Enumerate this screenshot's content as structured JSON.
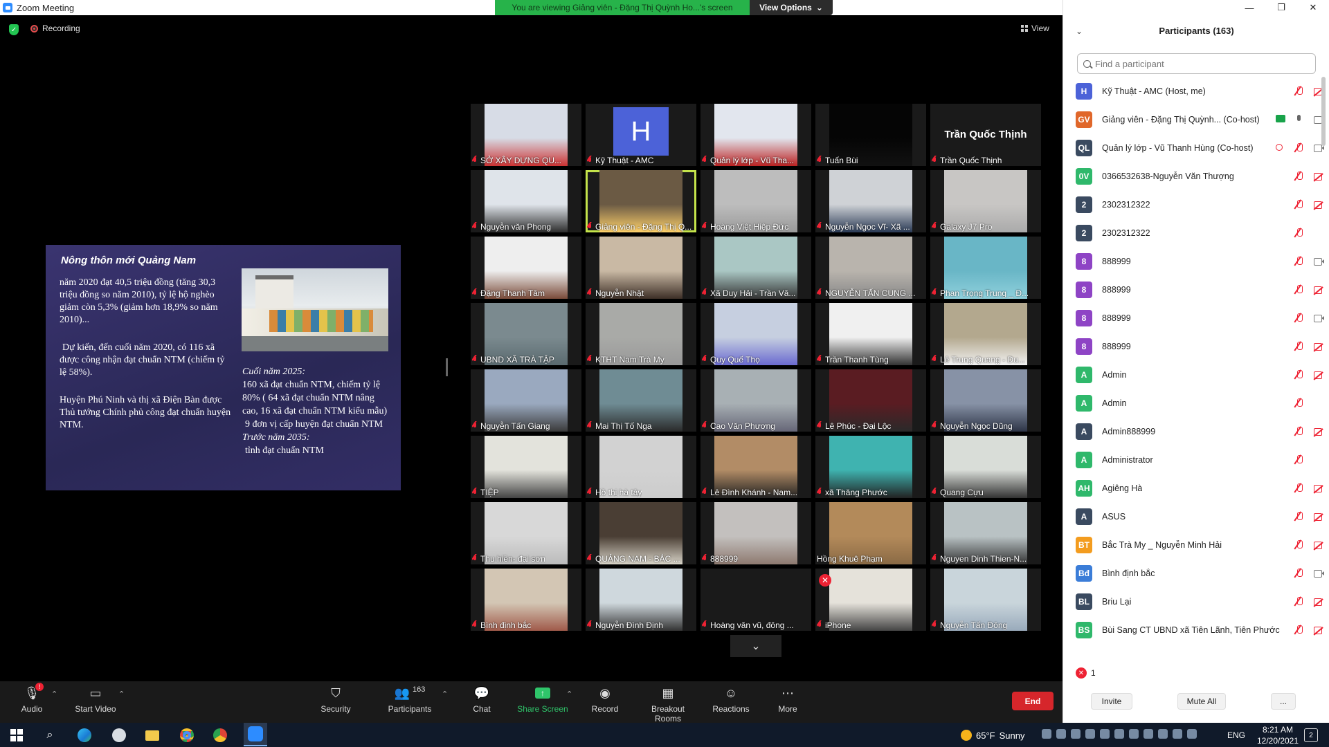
{
  "window": {
    "title": "Zoom Meeting",
    "share_banner": "You are viewing Giảng viên - Đặng Thị Quỳnh Ho...'s screen",
    "view_options": "View Options"
  },
  "meeting": {
    "recording_label": "Recording",
    "view_label": "View"
  },
  "slide": {
    "title": "Nông thôn mới Quảng Nam",
    "p1": "năm 2020 đạt 40,5 triệu đồng (tăng 30,3 triệu đồng so năm 2010), tỷ lệ hộ nghèo giảm còn 5,3% (giảm hơn 18,9% so năm 2010)...",
    "p2": "Dự kiến, đến cuối năm 2020, có 116 xã được công nhận đạt chuẩn NTM (chiếm tỷ lệ 58%).",
    "p3": "Huyện Phú Ninh và thị xã Điện Bàn được Thủ tướng Chính phủ công đạt chuẩn huyện NTM.",
    "p4_h1": "Cuối năm 2025:",
    "p4_t1": "160 xã đạt chuẩn NTM, chiếm tỷ lệ 80% ( 64 xã đạt chuẩn NTM nâng cao, 16 xã đạt chuẩn NTM kiểu mẫu)",
    "p4_t2": "9 đơn vị cấp huyện đạt chuẩn NTM",
    "p4_h2": "Trước năm 2035:",
    "p4_t3": "tỉnh đạt chuẩn NTM"
  },
  "gallery": [
    {
      "name": "SỞ XÂY DỰNG QU...",
      "kind": "video",
      "bg": "#d7dce6",
      "accent": "#c33"
    },
    {
      "name": "Kỹ Thuật - AMC",
      "kind": "avatar",
      "letter": "H"
    },
    {
      "name": "Quản lý lớp - Vũ Tha...",
      "kind": "video",
      "bg": "#e2e6ee",
      "accent": "#b22"
    },
    {
      "name": "Tuấn Bùi",
      "kind": "video",
      "bg": "#050505",
      "accent": "#111"
    },
    {
      "name": "Trần Quốc Thịnh",
      "kind": "nameonly",
      "big": "Trần Quốc Thịnh"
    },
    {
      "name": "Nguyễn văn Phong",
      "kind": "video",
      "bg": "#dfe4ea",
      "accent": "#2d2d2d"
    },
    {
      "name": "Giảng viên - Đặng Thị Q...",
      "kind": "video",
      "bg": "#6b5a44",
      "accent": "#ffd26b",
      "active": true
    },
    {
      "name": "Hoàng Việt Hiệp Đức",
      "kind": "video",
      "bg": "#bdbdbd",
      "accent": "#9a9a9a"
    },
    {
      "name": "Nguyễn Ngọc Vĩ- Xã ...",
      "kind": "video",
      "bg": "#cfd2d6",
      "accent": "#2a3a55"
    },
    {
      "name": "Galaxy J7 Pro",
      "kind": "video",
      "bg": "#c8c6c4",
      "accent": "#aaa"
    },
    {
      "name": "Đặng Thanh Tâm",
      "kind": "video",
      "bg": "#eeeeee",
      "accent": "#7a4b3a"
    },
    {
      "name": "Nguyễn Nhật",
      "kind": "video",
      "bg": "#c9b9a4",
      "accent": "#3d2f27"
    },
    {
      "name": "Xã Duy Hải - Trần Vă...",
      "kind": "video",
      "bg": "#aac7c4",
      "accent": "#333"
    },
    {
      "name": "NGUYỄN TẤN CUNG ...",
      "kind": "video",
      "bg": "#b9b4ad",
      "accent": "#888"
    },
    {
      "name": "Phan Trọng Trung _ Đ...",
      "kind": "video",
      "bg": "#69b6c6",
      "accent": "#8fd0dc"
    },
    {
      "name": "UBND XÃ TRÀ TẬP",
      "kind": "video",
      "bg": "#7b8a8f",
      "accent": "#5a6a6f"
    },
    {
      "name": "KTHT Nam Trà My",
      "kind": "video",
      "bg": "#a9aaa7",
      "accent": "#999"
    },
    {
      "name": "Quy Quế Thọ",
      "kind": "video",
      "bg": "#c6cfe0",
      "accent": "#6a6ad0"
    },
    {
      "name": "Trần Thanh Tùng",
      "kind": "video",
      "bg": "#f0f0f0",
      "accent": "#333"
    },
    {
      "name": "Lê Trung Quang - Du...",
      "kind": "video",
      "bg": "#b3a88e",
      "accent": "#f2f2f2"
    },
    {
      "name": "Nguyễn Tấn Giang",
      "kind": "video",
      "bg": "#9aa9bf",
      "accent": "#3a3a3a"
    },
    {
      "name": "Mai Thị Tố Nga",
      "kind": "video",
      "bg": "#6f8c94",
      "accent": "#2a2a2a"
    },
    {
      "name": "Cao Văn Phương",
      "kind": "video",
      "bg": "#a8b0b4",
      "accent": "#667"
    },
    {
      "name": "Lê Phúc - Đại Lộc",
      "kind": "video",
      "bg": "#5a1c22",
      "accent": "#2a2a2a"
    },
    {
      "name": "Nguyễn Ngọc Dũng",
      "kind": "video",
      "bg": "#8792a6",
      "accent": "#2d3446"
    },
    {
      "name": "TIỆP",
      "kind": "video",
      "bg": "#e3e3dc",
      "accent": "#444"
    },
    {
      "name": "Hồ thị hà tây",
      "kind": "video",
      "bg": "#d2d2d2",
      "accent": "#ccc"
    },
    {
      "name": "Lê Đình Khánh - Nam...",
      "kind": "video",
      "bg": "#b28c66",
      "accent": "#222"
    },
    {
      "name": "xã Thăng Phước",
      "kind": "video",
      "bg": "#3fb3b0",
      "accent": "#222"
    },
    {
      "name": "Quang Cựu",
      "kind": "video",
      "bg": "#d9ddd8",
      "accent": "#333"
    },
    {
      "name": "Thu hiền- đại sơn",
      "kind": "video",
      "bg": "#d8d8d8",
      "accent": "#bbb"
    },
    {
      "name": "QUẢNG NAM - BẮC ...",
      "kind": "video",
      "bg": "#4a3e34",
      "accent": "#d8d4c8"
    },
    {
      "name": "888999",
      "kind": "video",
      "bg": "#c3c0be",
      "accent": "#8e7a70"
    },
    {
      "name": "Hồng Khuê Phạm",
      "kind": "video",
      "bg": "#b38a5a",
      "accent": "#8a6a45",
      "nomic": true
    },
    {
      "name": "Nguyen Dinh Thien-N...",
      "kind": "video",
      "bg": "#b9c2c4",
      "accent": "#333"
    },
    {
      "name": "Bình định bắc",
      "kind": "video",
      "bg": "#d3c6b4",
      "accent": "#a05a4a"
    },
    {
      "name": "Nguyễn Đình Định",
      "kind": "video",
      "bg": "#cfd8dd",
      "accent": "#333"
    },
    {
      "name": "Hoàng văn vũ, đông ...",
      "kind": "blank"
    },
    {
      "name": "iPhone",
      "kind": "video",
      "bg": "#e5e2da",
      "accent": "#444",
      "xbadge": true
    },
    {
      "name": "Nguyễn Tấn Đông",
      "kind": "video",
      "bg": "#c9d5db",
      "accent": "#9ab"
    }
  ],
  "toolbar": {
    "audio": "Audio",
    "audio_badge": "!",
    "start_video": "Start Video",
    "security": "Security",
    "participants": "Participants",
    "participants_count": "163",
    "chat": "Chat",
    "share_screen": "Share Screen",
    "record": "Record",
    "breakout": "Breakout Rooms",
    "reactions": "Reactions",
    "more": "More",
    "end": "End"
  },
  "panel": {
    "title": "Participants (163)",
    "search_placeholder": "Find a participant",
    "participants": [
      {
        "initials": "H",
        "color": "#4c62d8",
        "name": "Kỹ Thuật - AMC (Host, me)",
        "mic": "off",
        "video": "off"
      },
      {
        "initials": "GV",
        "color": "#e0672a",
        "name": "Giảng viên - Đặng Thị Quỳnh... (Co-host)",
        "mic": "on",
        "video": "on",
        "sharing": true
      },
      {
        "initials": "QL",
        "color": "#3a4a60",
        "name": "Quản lý lớp - Vũ Thanh Hùng (Co-host)",
        "mic": "off",
        "video": "on",
        "recording": true
      },
      {
        "initials": "0V",
        "color": "#2fb86b",
        "name": "0366532638-Nguyễn Văn Thượng",
        "mic": "off",
        "video": "off"
      },
      {
        "initials": "2",
        "color": "#3a4a60",
        "name": "2302312322",
        "mic": "off",
        "video": "off"
      },
      {
        "initials": "2",
        "color": "#3a4a60",
        "name": "2302312322",
        "mic": "off",
        "video": "none"
      },
      {
        "initials": "8",
        "color": "#8e44c5",
        "name": "888999",
        "mic": "off",
        "video": "on"
      },
      {
        "initials": "8",
        "color": "#8e44c5",
        "name": "888999",
        "mic": "off",
        "video": "off"
      },
      {
        "initials": "8",
        "color": "#8e44c5",
        "name": "888999",
        "mic": "off",
        "video": "on"
      },
      {
        "initials": "8",
        "color": "#8e44c5",
        "name": "888999",
        "mic": "off",
        "video": "off"
      },
      {
        "initials": "A",
        "color": "#2fb86b",
        "name": "Admin",
        "mic": "off",
        "video": "off"
      },
      {
        "initials": "A",
        "color": "#2fb86b",
        "name": "Admin",
        "mic": "off",
        "video": "none"
      },
      {
        "initials": "A",
        "color": "#3a4a60",
        "name": "Admin888999",
        "mic": "off",
        "video": "off"
      },
      {
        "initials": "A",
        "color": "#2fb86b",
        "name": "Administrator",
        "mic": "off",
        "video": "none"
      },
      {
        "initials": "AH",
        "color": "#2fb86b",
        "name": "Agiêng Hà",
        "mic": "off",
        "video": "off"
      },
      {
        "initials": "A",
        "color": "#3a4a60",
        "name": "ASUS",
        "mic": "off",
        "video": "off"
      },
      {
        "initials": "BT",
        "color": "#f39c1f",
        "name": "Bắc Trà My _ Nguyễn Minh Hải",
        "mic": "off",
        "video": "off"
      },
      {
        "initials": "Bđ",
        "color": "#3b7dd8",
        "name": "Bình định bắc",
        "mic": "off",
        "video": "on"
      },
      {
        "initials": "BL",
        "color": "#3a4a60",
        "name": "Briu Lại",
        "mic": "off",
        "video": "off"
      },
      {
        "initials": "BS",
        "color": "#2fb86b",
        "name": "Bùi Sang CT UBND xã Tiên Lãnh, Tiên Phước",
        "mic": "off",
        "video": "off"
      }
    ],
    "raised_count": "1",
    "invite": "Invite",
    "mute_all": "Mute All",
    "more": "..."
  },
  "taskbar": {
    "temperature": "65°F",
    "weather": "Sunny",
    "lang": "ENG",
    "time": "8:21 AM",
    "date": "12/20/2021",
    "notif_count": "2"
  }
}
